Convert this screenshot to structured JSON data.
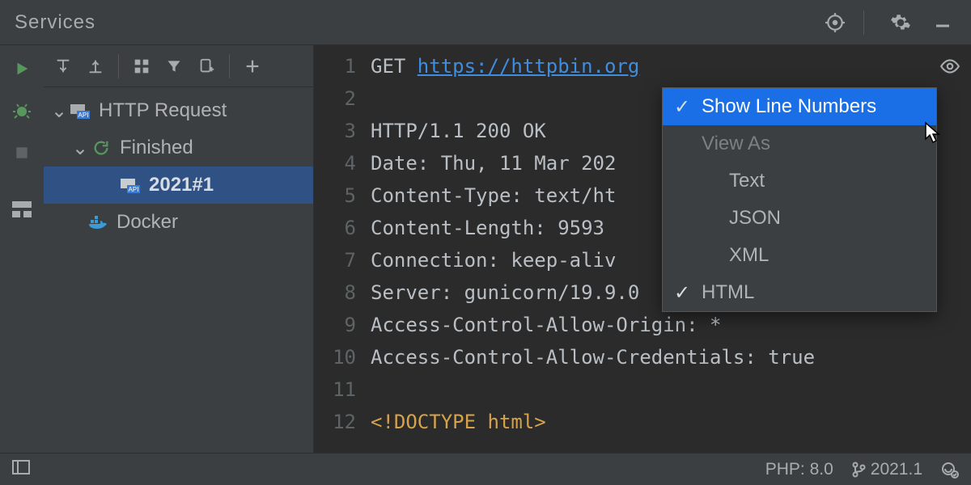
{
  "title": "Services",
  "tree": {
    "http_request": "HTTP Request",
    "finished": "Finished",
    "active": "2021#1",
    "docker": "Docker"
  },
  "editor": {
    "lines": [
      {
        "n": "1",
        "method": "GET ",
        "url": "https://httpbin.org"
      },
      {
        "n": "2",
        "text": ""
      },
      {
        "n": "3",
        "text": "HTTP/1.1 200 OK"
      },
      {
        "n": "4",
        "text": "Date: Thu, 11 Mar 202"
      },
      {
        "n": "5",
        "text": "Content-Type: text/ht"
      },
      {
        "n": "6",
        "text": "Content-Length: 9593"
      },
      {
        "n": "7",
        "text": "Connection: keep-aliv"
      },
      {
        "n": "8",
        "text": "Server: gunicorn/19.9.0"
      },
      {
        "n": "9",
        "text": "Access-Control-Allow-Origin: *"
      },
      {
        "n": "10",
        "text": "Access-Control-Allow-Credentials: true"
      },
      {
        "n": "11",
        "text": ""
      },
      {
        "n": "12",
        "html": "<!DOCTYPE html>"
      }
    ]
  },
  "popup": {
    "show_line_numbers": "Show Line Numbers",
    "view_as": "View As",
    "options": {
      "text": "Text",
      "json": "JSON",
      "xml": "XML",
      "html": "HTML"
    }
  },
  "status": {
    "php": "PHP: 8.0",
    "branch": "2021.1"
  }
}
